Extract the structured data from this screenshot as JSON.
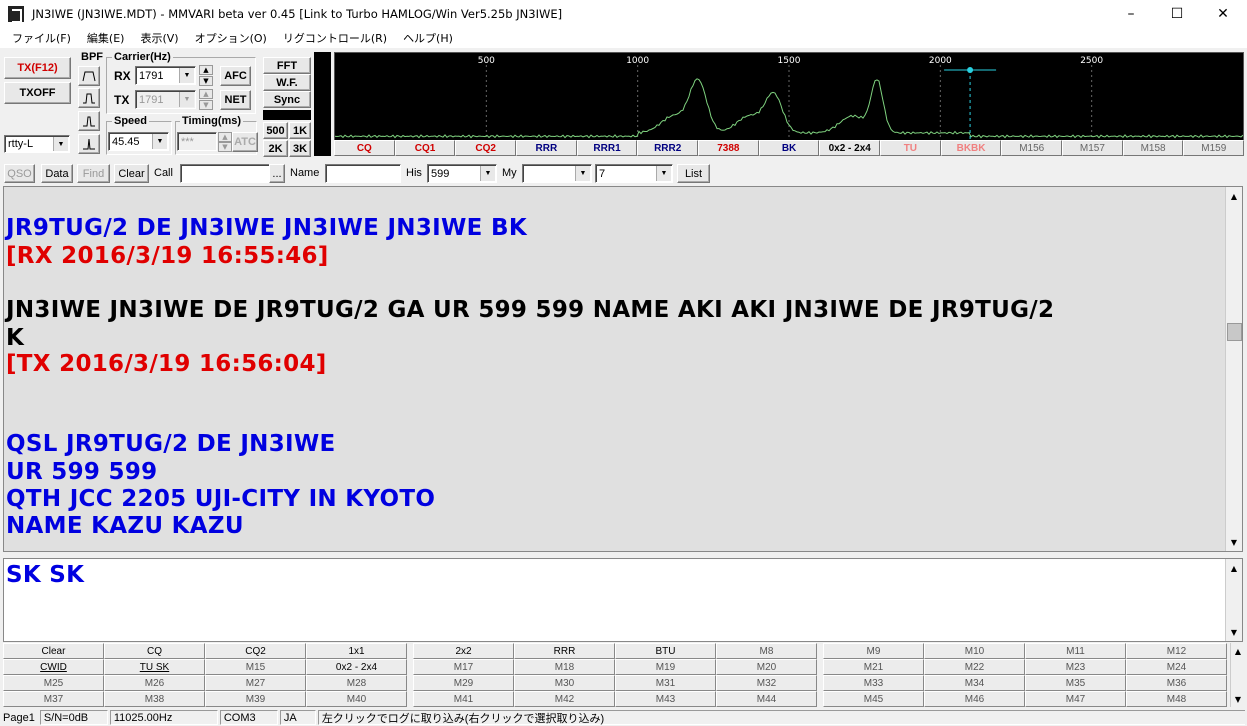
{
  "window": {
    "title": "JN3IWE (JN3IWE.MDT) - MMVARI beta ver 0.45 [Link to Turbo HAMLOG/Win Ver5.25b JN3IWE]",
    "minimize": "–",
    "maximize": "☐",
    "close": "✕"
  },
  "menu": [
    "ファイル(F)",
    "編集(E)",
    "表示(V)",
    "オプション(O)",
    "リグコントロール(R)",
    "ヘルプ(H)"
  ],
  "controls": {
    "tx_button": "TX(F12)",
    "txoff_button": "TXOFF",
    "mode_value": "rtty-L",
    "bpf_label": "BPF",
    "carrier_label": "Carrier(Hz)",
    "rx_label": "RX",
    "rx_value": "1791",
    "tx_label": "TX",
    "tx_value": "1791",
    "afc_button": "AFC",
    "net_button": "NET",
    "speed_label": "Speed",
    "speed_value": "45.45",
    "timing_label": "Timing(ms)",
    "timing_value": "***",
    "atc_button": "ATC",
    "fft_button": "FFT",
    "wf_button": "W.F.",
    "sync_button": "Sync",
    "span_500": "500",
    "span_1k": "1K",
    "span_2k": "2K",
    "span_3k": "3K"
  },
  "spectrum": {
    "freq_labels": [
      "500",
      "1000",
      "1500",
      "2000",
      "2500"
    ],
    "peak_freqs_hz": [
      1200,
      1450,
      1791
    ],
    "rx_marker_hz": 1791,
    "trace_color": "#7fd27f",
    "background": "#000000"
  },
  "macro_bar": [
    {
      "label": "CQ",
      "color": "#d00000"
    },
    {
      "label": "CQ1",
      "color": "#d00000"
    },
    {
      "label": "CQ2",
      "color": "#d00000"
    },
    {
      "label": "RRR",
      "color": "#000080"
    },
    {
      "label": "RRR1",
      "color": "#000080"
    },
    {
      "label": "RRR2",
      "color": "#000080"
    },
    {
      "label": "7388",
      "color": "#d00000"
    },
    {
      "label": "BK",
      "color": "#000080"
    },
    {
      "label": "0x2 - 2x4",
      "color": "#000000"
    },
    {
      "label": "TU",
      "color": "#f08080"
    },
    {
      "label": "BKBK",
      "color": "#f08080"
    },
    {
      "label": "M156",
      "color": "#666666"
    },
    {
      "label": "M157",
      "color": "#666666"
    },
    {
      "label": "M158",
      "color": "#666666"
    },
    {
      "label": "M159",
      "color": "#666666"
    }
  ],
  "toolbar": {
    "qso_button": "QSO",
    "data_button": "Data",
    "find_button": "Find",
    "clear_button": "Clear",
    "call_label": "Call",
    "call_value": "",
    "ellipsis_button": "...",
    "name_label": "Name",
    "name_value": "",
    "his_label": "His",
    "his_value": "599",
    "my_label": "My",
    "my_value": "",
    "band_value": "7",
    "list_button": "List"
  },
  "rx_text": [
    {
      "text": "JR9TUG/2 DE JN3IWE JN3IWE JN3IWE BK",
      "color": "#0000e0"
    },
    {
      "text": "[RX 2016/3/19 16:55:46]",
      "color": "#e00000"
    },
    {
      "text": "",
      "color": "#000000"
    },
    {
      "text": "JN3IWE JN3IWE DE JR9TUG/2 GA UR 599 599 NAME AKI AKI JN3IWE DE JR9TUG/2",
      "color": "#000000"
    },
    {
      "text": "K",
      "color": "#000000"
    },
    {
      "text": "[TX 2016/3/19 16:56:04]",
      "color": "#e00000"
    },
    {
      "text": "",
      "color": "#000000"
    },
    {
      "text": "",
      "color": "#000000"
    },
    {
      "text": "QSL JR9TUG/2 DE JN3IWE",
      "color": "#0000e0"
    },
    {
      "text": "UR 599 599",
      "color": "#0000e0"
    },
    {
      "text": "QTH JCC 2205 UJI-CITY IN KYOTO",
      "color": "#0000e0"
    },
    {
      "text": "NAME KAZU KAZU",
      "color": "#0000e0"
    }
  ],
  "tx_text": {
    "text": "SK SK",
    "color": "#0000e0"
  },
  "macros_left": [
    [
      "Clear",
      "CQ",
      "CQ2",
      "1x1"
    ],
    [
      "CWID",
      "TU SK",
      "M15",
      "0x2 - 2x4"
    ],
    [
      "M25",
      "M26",
      "M27",
      "M28"
    ],
    [
      "M37",
      "M38",
      "M39",
      "M40"
    ]
  ],
  "macros_mid": [
    [
      "2x2",
      "RRR",
      "BTU",
      "M8"
    ],
    [
      "M17",
      "M18",
      "M19",
      "M20"
    ],
    [
      "M29",
      "M30",
      "M31",
      "M32"
    ],
    [
      "M41",
      "M42",
      "M43",
      "M44"
    ]
  ],
  "macros_right": [
    [
      "M9",
      "M10",
      "M11",
      "M12"
    ],
    [
      "M21",
      "M22",
      "M23",
      "M24"
    ],
    [
      "M33",
      "M34",
      "M35",
      "M36"
    ],
    [
      "M45",
      "M46",
      "M47",
      "M48"
    ]
  ],
  "status": {
    "page": "Page1",
    "sn": "S/N=0dB",
    "clock": "11025.00Hz",
    "port": "COM3",
    "lang": "JA",
    "hint": "左クリックでログに取り込み(右クリックで選択取り込み)"
  }
}
